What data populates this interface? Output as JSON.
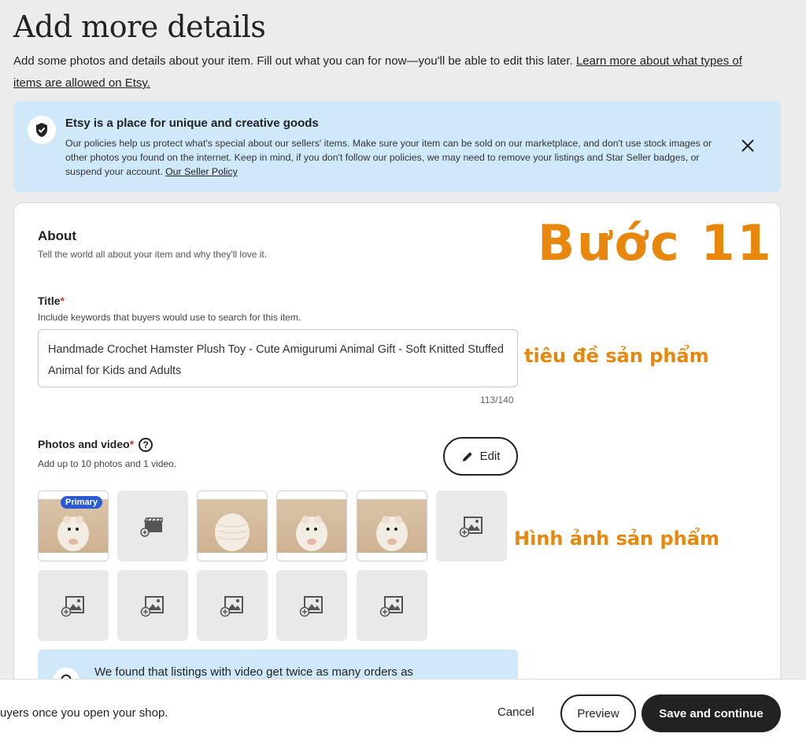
{
  "header": {
    "title": "Add more details",
    "intro": "Add some photos and details about your item. Fill out what you can for now—you'll be able to edit this later.",
    "learn_more_link": "Learn more about what types of items are allowed on Etsy."
  },
  "banner": {
    "title": "Etsy is a place for unique and creative goods",
    "text": "Our policies help us protect what's special about our sellers' items. Make sure your item can be sold on our marketplace, and don't use stock images or other photos you found on the internet. Keep in mind, if you don't follow our policies, we may need to remove your listings and Star Seller badges, or suspend your account.",
    "link": "Our Seller Policy"
  },
  "about": {
    "title": "About",
    "subtitle": "Tell the world all about your item and why they'll love it."
  },
  "annotations": {
    "step": "Bước 11",
    "title_note": "tiêu đề sản phẩm",
    "photos_note": "Hình ảnh sản phẩm"
  },
  "title_field": {
    "label": "Title",
    "required_mark": "*",
    "help": "Include keywords that buyers would use to search for this item.",
    "value": "Handmade Crochet Hamster Plush Toy - Cute Amigurumi Animal Gift - Soft Knitted Stuffed Animal for Kids and Adults",
    "counter": "113/140"
  },
  "photos": {
    "label": "Photos and video",
    "required_mark": "*",
    "help_icon": "?",
    "help": "Add up to 10 photos and 1 video.",
    "edit_label": "Edit",
    "primary_badge": "Primary"
  },
  "info": {
    "text": "We found that listings with video get twice as many orders as"
  },
  "footer": {
    "text": "uyers once you open your shop.",
    "cancel_label": "Cancel",
    "preview_label": "Preview",
    "save_label": "Save and continue"
  },
  "colors": {
    "accent_orange": "#e8870c",
    "banner_blue": "#cfe8fa",
    "primary_badge": "#2a5bd7",
    "dark_button": "#222222"
  }
}
